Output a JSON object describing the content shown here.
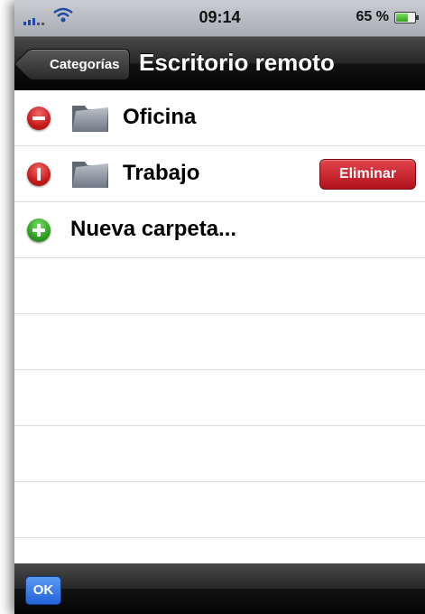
{
  "status_bar": {
    "time": "09:14",
    "battery_percent": "65 %",
    "battery_level": 0.65
  },
  "nav": {
    "back_label": "Categorías",
    "title": "Escritorio remoto"
  },
  "rows": [
    {
      "label": "Oficina",
      "control": "delete-minus",
      "icon": "folder-icon"
    },
    {
      "label": "Trabajo",
      "control": "delete-confirm",
      "icon": "folder-icon",
      "action_label": "Eliminar"
    },
    {
      "label": "Nueva carpeta...",
      "control": "insert-plus"
    }
  ],
  "toolbar": {
    "ok_label": "OK"
  },
  "colors": {
    "delete_red": "#c81b1b",
    "insert_green": "#2da020",
    "ok_blue": "#2263d8"
  }
}
